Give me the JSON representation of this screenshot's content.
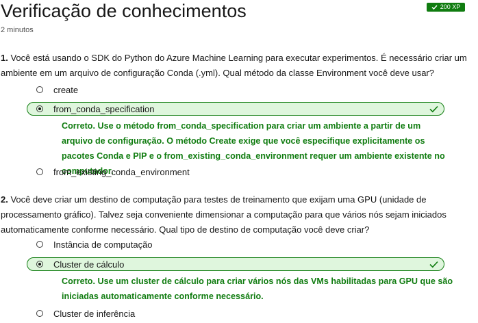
{
  "header": {
    "title": "Verificação de conhecimentos",
    "duration": "2 minutos",
    "xp_badge": "200 XP"
  },
  "questions": [
    {
      "number": "1.",
      "text": "Você está usando o SDK do Python do Azure Machine Learning para executar experimentos. É necessário criar um ambiente em um arquivo de configuração Conda (.yml). Qual método da classe Environment você deve usar?",
      "options": [
        {
          "label": "create",
          "selected": false
        },
        {
          "label": "from_conda_specification",
          "selected": true
        },
        {
          "label": "from_existing_conda_environment",
          "selected": false
        }
      ],
      "feedback": "Correto. Use o método from_conda_specification para criar um ambiente a partir de um arquivo de configuração. O método Create exige que você especifique explicitamente os pacotes Conda e PIP e o from_existing_conda_environment requer um ambiente existente no computador."
    },
    {
      "number": "2.",
      "text": "Você deve criar um destino de computação para testes de treinamento que exijam uma GPU (unidade de processamento gráfico). Talvez seja conveniente dimensionar a computação para que vários nós sejam iniciados automaticamente conforme necessário. Qual tipo de destino de computação você deve criar?",
      "options": [
        {
          "label": "Instância de computação",
          "selected": false
        },
        {
          "label": "Cluster de cálculo",
          "selected": true
        },
        {
          "label": "Cluster de inferência",
          "selected": false
        }
      ],
      "feedback": "Correto. Use um cluster de cálculo para criar vários nós das VMs habilitadas para GPU que são iniciadas automaticamente conforme necessário."
    }
  ],
  "colors": {
    "success": "#107c10",
    "selected_bg": "#dff6dd",
    "text": "#171717"
  },
  "icons": {
    "badge": "checkmark-icon",
    "selected_option": "checkmark-icon"
  }
}
